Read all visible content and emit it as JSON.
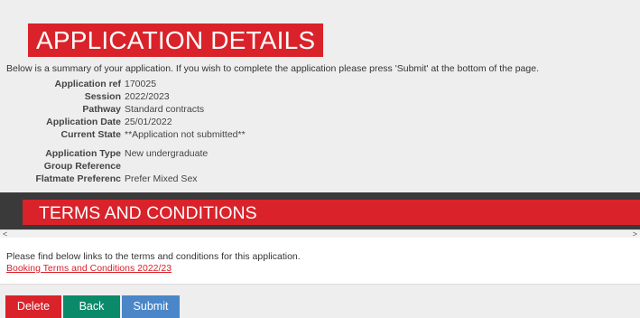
{
  "header": {
    "title": "APPLICATION DETAILS",
    "summary": "Below is a summary of your application. If you wish to complete the application please press 'Submit' at the bottom of the page."
  },
  "fields": [
    {
      "label": "Application ref",
      "value": "170025"
    },
    {
      "label": "Session",
      "value": "2022/2023"
    },
    {
      "label": "Pathway",
      "value": "Standard contracts"
    },
    {
      "label": "Application Date",
      "value": "25/01/2022"
    },
    {
      "label": "Current State",
      "value": "**Application not submitted**"
    },
    {
      "label": "Application Type",
      "value": "New undergraduate"
    },
    {
      "label": "Group Reference",
      "value": ""
    },
    {
      "label": "Flatmate Preferenc",
      "value": "Prefer Mixed Sex"
    }
  ],
  "terms": {
    "title": "TERMS AND CONDITIONS",
    "intro": "Please find below links to the terms and conditions for this application.",
    "link_text": "Booking Terms and Conditions 2022/23"
  },
  "scrollbar": {
    "left_arrow": "<",
    "right_arrow": ">"
  },
  "actions": {
    "delete_label": "Delete",
    "back_label": "Back",
    "submit_label": "Submit"
  },
  "colors": {
    "brand_red": "#d9222a",
    "back_green": "#0b8a6a",
    "submit_blue": "#4a86c8",
    "panel_grey": "#eeeeee",
    "band_dark": "#3a3a3a"
  }
}
